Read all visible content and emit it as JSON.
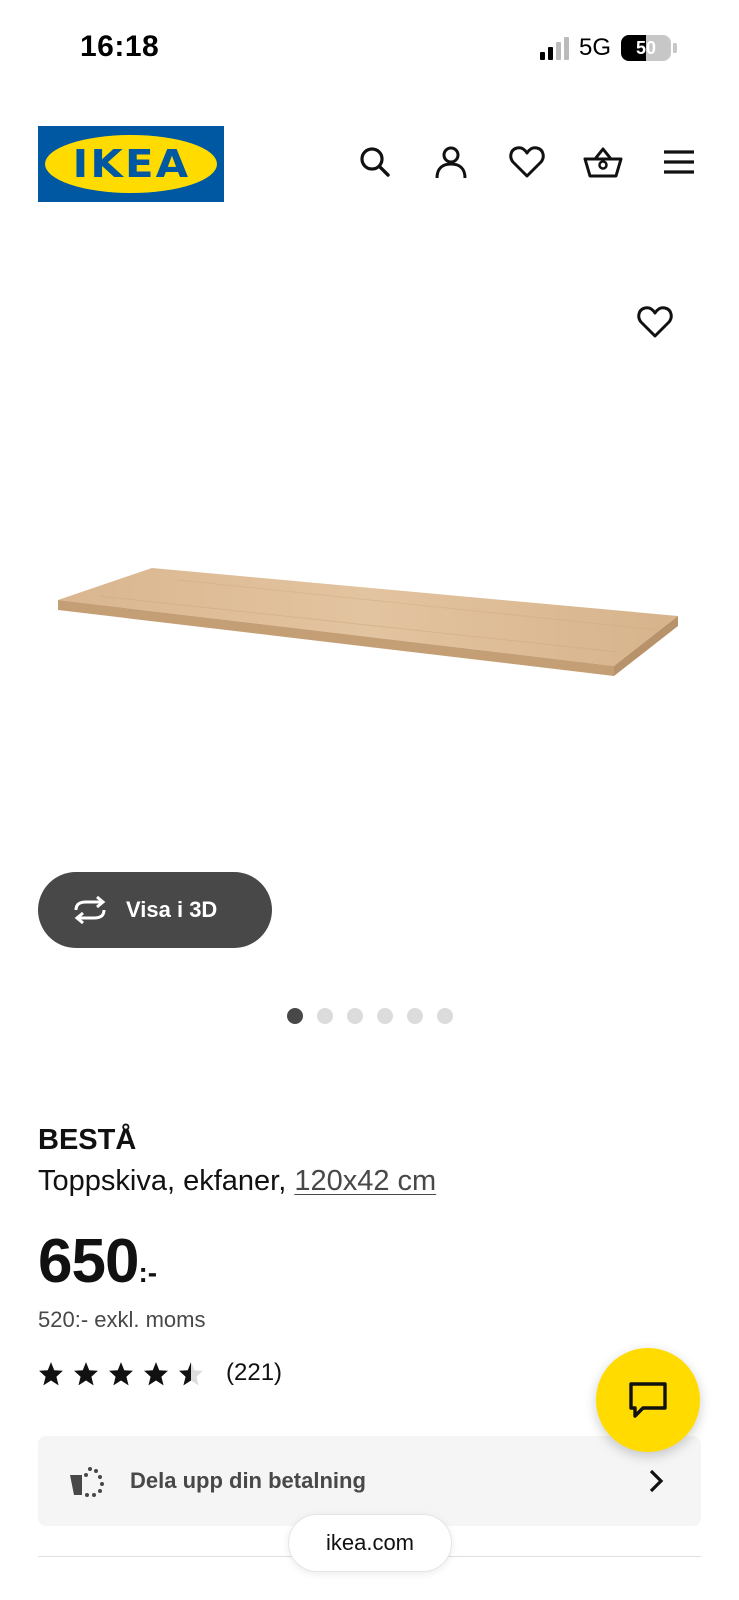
{
  "status_bar": {
    "time": "16:18",
    "network": "5G",
    "battery": "50"
  },
  "header": {
    "logo_text": "IKEA",
    "icons": [
      "search-icon",
      "account-icon",
      "heart-icon",
      "basket-icon",
      "menu-icon"
    ]
  },
  "gallery": {
    "view_3d_label": "Visa i 3D",
    "dots_total": 6,
    "active_dot": 1
  },
  "product": {
    "brand": "BESTÅ",
    "description": "Toppskiva, ekfaner,",
    "size_link": "120x42 cm",
    "price_main": "650",
    "price_suffix": ":-",
    "price_ex_vat": "520:- exkl. moms",
    "rating_value": 4.5,
    "rating_count": "(221)"
  },
  "payment": {
    "label": "Dela upp din betalning"
  },
  "browser": {
    "url": "ikea.com"
  },
  "colors": {
    "ikea_blue": "#0058a3",
    "ikea_yellow": "#ffdb00",
    "dark_gray": "#484848"
  }
}
